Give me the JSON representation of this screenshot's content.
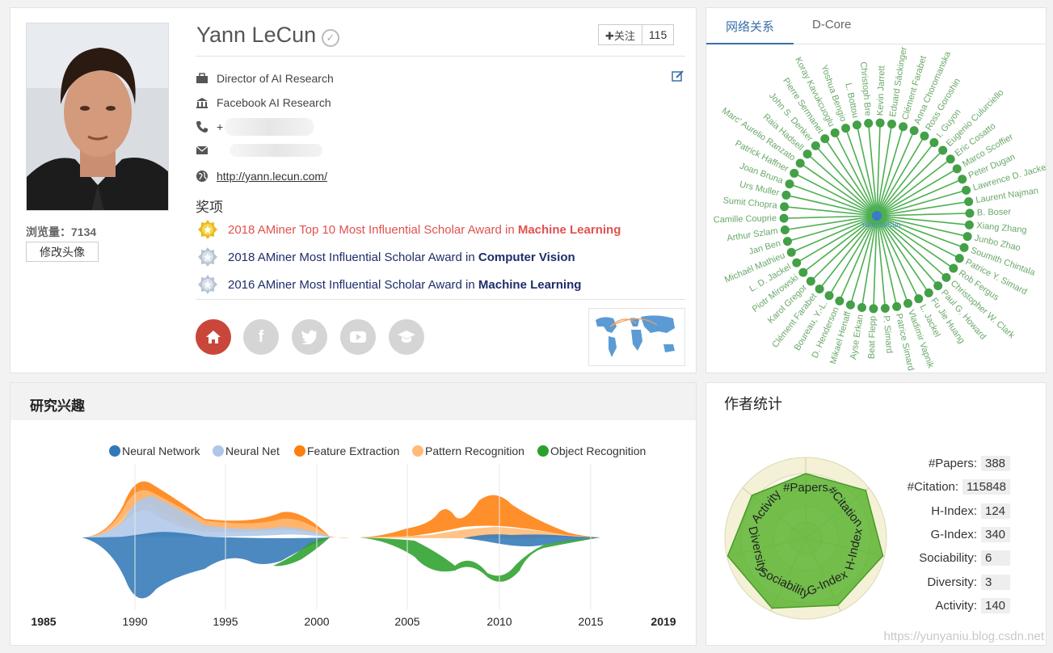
{
  "profile": {
    "name": "Yann LeCun",
    "views_label": "浏览量：",
    "views_value": "7134",
    "change_avatar": "修改头像",
    "follow_label": "✚关注",
    "follow_count": "115",
    "position": "Director of AI Research",
    "affiliation": "Facebook AI Research",
    "phone_prefix": "+",
    "homepage": "http://yann.lecun.com/",
    "awards_title": "奖项",
    "awards": [
      {
        "text": "2018 AMiner Top 10 Most Influential Scholar Award in ",
        "field": "Machine Learning",
        "color": "#e0524f",
        "medal": "gold"
      },
      {
        "text": "2018 AMiner Most Influential Scholar Award in ",
        "field": "Computer Vision",
        "color": "#1f2d6b",
        "medal": "silver"
      },
      {
        "text": "2016 AMiner Most Influential Scholar Award in ",
        "field": "Machine Learning",
        "color": "#1f2d6b",
        "medal": "silver"
      }
    ],
    "social_icons": [
      "home-icon",
      "facebook-icon",
      "twitter-icon",
      "youtube-icon",
      "scholar-icon"
    ]
  },
  "network": {
    "tabs": [
      "网络关系",
      "D-Core"
    ],
    "center": "Yann LeCun",
    "nodes": [
      "Christoph Bre",
      "Kevin Jarrett",
      "Eduard Säckinger",
      "Clément Farabet",
      "Anna Choromanska",
      "Ross Goroshin",
      "I. Guyon",
      "Eugenio Culurciello",
      "Eric Cosatto",
      "Marco Scoffier",
      "Peter Dugan",
      "Lawrence D. Jackel",
      "Laurent Najman",
      "B. Boser",
      "Xiang Zhang",
      "Junbo Zhao",
      "Soumith Chintala",
      "Patrice Y. Simard",
      "Rob Fergus",
      "Christopher W. Clark",
      "Paul G. Howard",
      "Fu Jie Huang",
      "L. Jackel",
      "Vladimir Vapnik",
      "Patrice Simard",
      "P. Simard",
      "Beat Flepp",
      "Ayse Erkan",
      "Mikael Henaff",
      "D. Henderson",
      "Boureau, Y.-L.",
      "Clément Farabet",
      "Karol Gregor",
      "Piotr Mirowski",
      "L. D. Jackel",
      "Michaël Mathieu",
      "Jan Ben",
      "Arthur Szlam",
      "Camille Couprie",
      "Sumit Chopra",
      "Urs Muller",
      "Joan Bruna",
      "Patrick Haffner",
      "Marc' Aurelio Ranzato",
      "Raia Hadsell",
      "John S. Denker",
      "Pierre Sermanet",
      "Koray Kavukcuoglu",
      "Yoshua Bengio",
      "L. Bottou"
    ]
  },
  "interest": {
    "title": "研究兴趣",
    "legend": [
      {
        "name": "Neural Network",
        "color": "#3279b7"
      },
      {
        "name": "Neural Net",
        "color": "#aec7e8"
      },
      {
        "name": "Feature Extraction",
        "color": "#ff7f0e"
      },
      {
        "name": "Pattern Recognition",
        "color": "#ffbb78"
      },
      {
        "name": "Object Recognition",
        "color": "#2ca02c"
      }
    ],
    "axis_labels": [
      "1985",
      "1990",
      "1995",
      "2000",
      "2005",
      "2010",
      "2015",
      "2019"
    ]
  },
  "stats": {
    "title": "作者统计",
    "radar_axes": [
      "#Papers",
      "#Citation",
      "H-Index",
      "G-Index",
      "Sociability",
      "Diversity",
      "Activity"
    ],
    "rows": [
      {
        "label": "#Papers:",
        "value": "388"
      },
      {
        "label": "#Citation:",
        "value": "115848"
      },
      {
        "label": "H-Index:",
        "value": "124"
      },
      {
        "label": "G-Index:",
        "value": "340"
      },
      {
        "label": "Sociability:",
        "value": "6"
      },
      {
        "label": "Diversity:",
        "value": "3"
      },
      {
        "label": "Activity:",
        "value": "140"
      }
    ]
  },
  "watermark": "https://yunyaniu.blog.csdn.net"
}
